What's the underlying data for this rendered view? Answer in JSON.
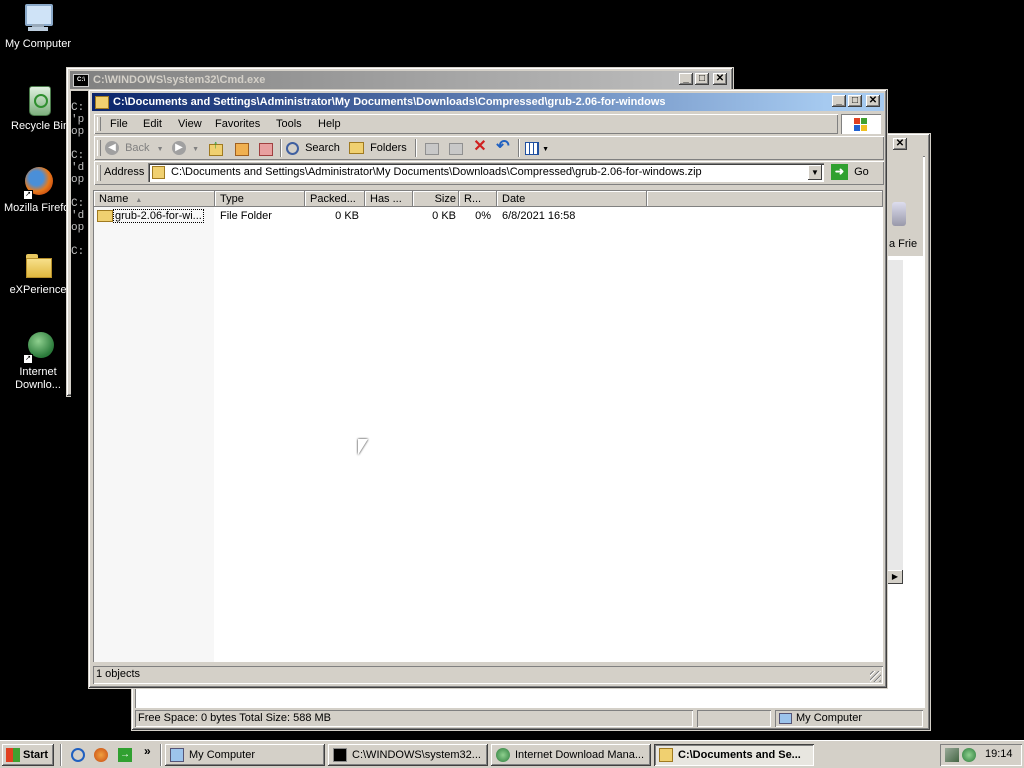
{
  "desktop": {
    "icons": [
      {
        "label": "My Computer"
      },
      {
        "label": "Recycle Bin"
      },
      {
        "label": "Mozilla Firefox"
      },
      {
        "label": "eXPerience"
      },
      {
        "label": "Internet Downlo..."
      }
    ]
  },
  "cmd_window": {
    "title": "C:\\WINDOWS\\system32\\Cmd.exe",
    "lines": [
      "C:",
      "'p",
      "op",
      "",
      "C:",
      "'d",
      "op",
      "",
      "C:",
      "'d",
      "op",
      "",
      "C:"
    ]
  },
  "mycomputer_window": {
    "partial_label": "a Frie",
    "status": {
      "free_space": "Free Space: 0 bytes Total Size: 588 MB",
      "zone": "My Computer"
    }
  },
  "explorer": {
    "title": "C:\\Documents and Settings\\Administrator\\My Documents\\Downloads\\Compressed\\grub-2.06-for-windows",
    "menu": [
      "File",
      "Edit",
      "View",
      "Favorites",
      "Tools",
      "Help"
    ],
    "toolbar": {
      "back": "Back",
      "search": "Search",
      "folders": "Folders"
    },
    "address_label": "Address",
    "address_value": "C:\\Documents and Settings\\Administrator\\My Documents\\Downloads\\Compressed\\grub-2.06-for-windows.zip",
    "go_label": "Go",
    "columns": [
      "Name",
      "Type",
      "Packed...",
      "Has ...",
      "Size",
      "R...",
      "Date"
    ],
    "rows": [
      {
        "name": "grub-2.06-for-wi...",
        "type": "File Folder",
        "packed": "0 KB",
        "has": "",
        "size": "0 KB",
        "ratio": "0%",
        "date": "6/8/2021 16:58"
      }
    ],
    "status": "1 objects"
  },
  "taskbar": {
    "start": "Start",
    "more": "»",
    "buttons": [
      {
        "label": "My Computer"
      },
      {
        "label": "C:\\WINDOWS\\system32..."
      },
      {
        "label": "Internet Download Mana..."
      },
      {
        "label": "C:\\Documents and Se..."
      }
    ],
    "clock": "19:14"
  },
  "colors": {
    "titlebar_active": "#0a246a",
    "desktop": "#000000",
    "face": "#d4d0c8"
  }
}
